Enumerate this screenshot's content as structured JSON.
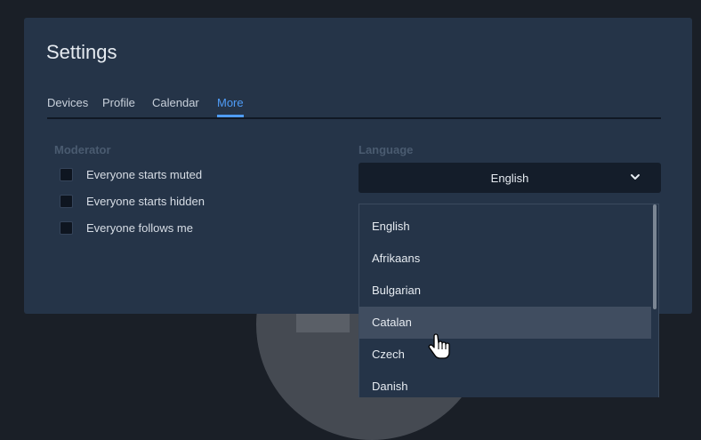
{
  "settings": {
    "title": "Settings",
    "tabs": [
      {
        "label": "Devices"
      },
      {
        "label": "Profile"
      },
      {
        "label": "Calendar"
      },
      {
        "label": "More",
        "active": true
      }
    ],
    "moderator": {
      "label": "Moderator",
      "options": [
        {
          "label": "Everyone starts muted",
          "checked": false
        },
        {
          "label": "Everyone starts hidden",
          "checked": false
        },
        {
          "label": "Everyone follows me",
          "checked": false
        }
      ]
    },
    "language": {
      "label": "Language",
      "selected": "English",
      "options": [
        "English",
        "Afrikaans",
        "Bulgarian",
        "Catalan",
        "Czech",
        "Danish"
      ],
      "hovered": "Catalan"
    }
  },
  "icons": {
    "select_chevron": "chevron-down-icon",
    "cursor": "hand-pointer-icon"
  },
  "colors": {
    "accent": "#4f9cf7",
    "dialog_bg": "#253448",
    "select_bg": "#141d2a",
    "hover_bg": "#404d60"
  }
}
